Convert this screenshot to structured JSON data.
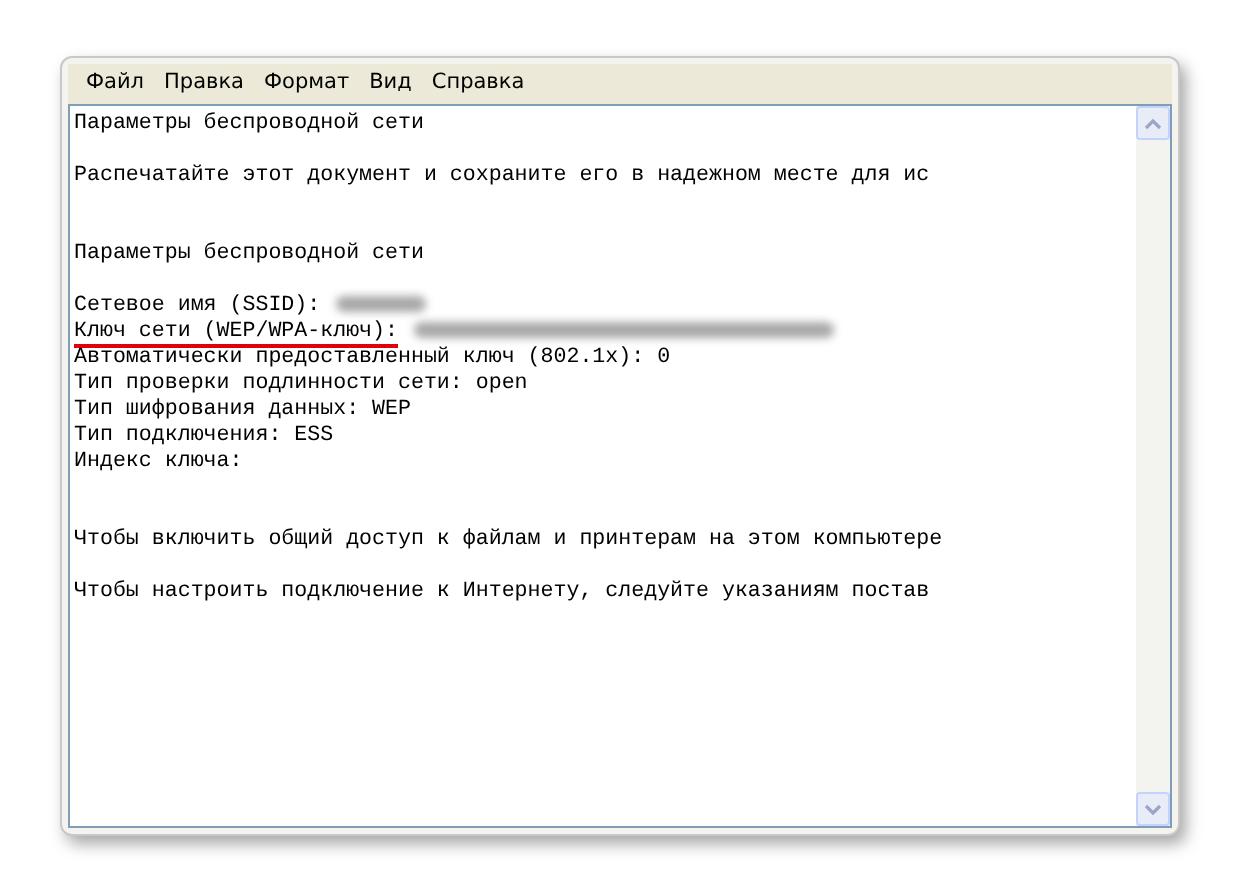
{
  "menu": [
    "Файл",
    "Правка",
    "Формат",
    "Вид",
    "Справка"
  ],
  "lines": [
    {
      "kind": "text",
      "text": "Параметры беспроводной сети"
    },
    {
      "kind": "blank"
    },
    {
      "kind": "text",
      "text": "Распечатайте этот документ и сохраните его в надежном месте для ис"
    },
    {
      "kind": "blank"
    },
    {
      "kind": "blank"
    },
    {
      "kind": "text",
      "text": "Параметры беспроводной сети"
    },
    {
      "kind": "blank"
    },
    {
      "kind": "text",
      "text": "Сетевое имя (SSID):",
      "redacted": true,
      "underlined": false
    },
    {
      "kind": "text",
      "text": "Ключ сети (WEP/WPA-ключ):",
      "redacted": true,
      "underlined": true
    },
    {
      "kind": "text",
      "text": "Автоматически предоставленный ключ (802.1x): 0"
    },
    {
      "kind": "text",
      "text": "Тип проверки подлинности сети: open"
    },
    {
      "kind": "text",
      "text": "Тип шифрования данных: WEP"
    },
    {
      "kind": "text",
      "text": "Тип подключения: ESS"
    },
    {
      "kind": "text",
      "text": "Индекс ключа:"
    },
    {
      "kind": "blank"
    },
    {
      "kind": "blank"
    },
    {
      "kind": "text",
      "text": "Чтобы включить общий доступ к файлам и принтерам на этом компьютере"
    },
    {
      "kind": "blank"
    },
    {
      "kind": "text",
      "text": "Чтобы настроить подключение к Интернету, следуйте указаниям постав"
    }
  ]
}
